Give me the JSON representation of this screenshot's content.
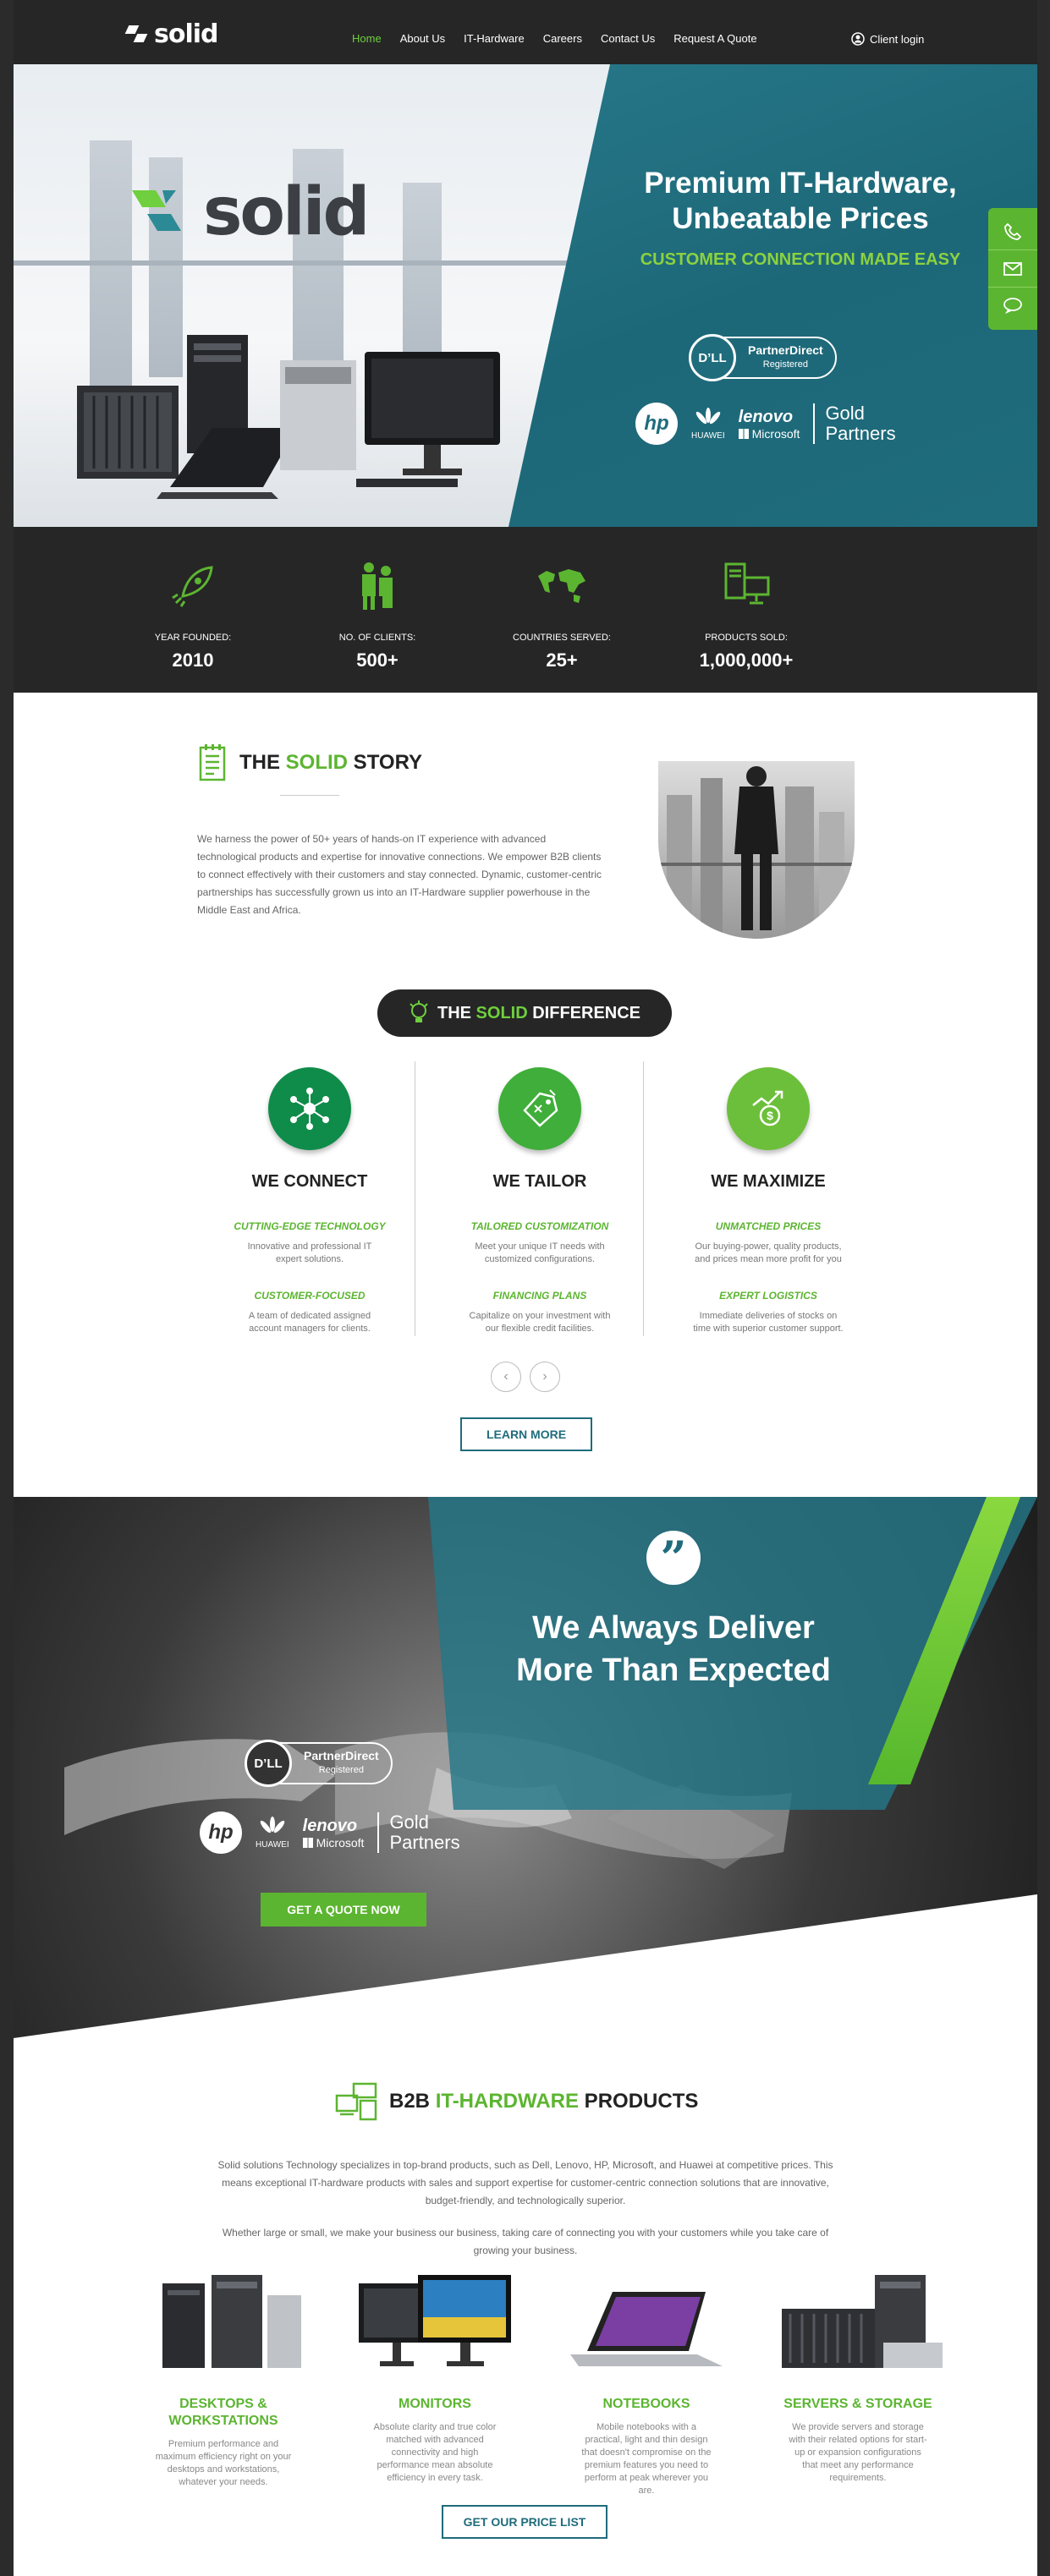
{
  "nav": {
    "logo": "solid",
    "items": [
      {
        "label": "Home",
        "active": true
      },
      {
        "label": "About Us"
      },
      {
        "label": "IT-Hardware"
      },
      {
        "label": "Careers"
      },
      {
        "label": "Contact Us"
      },
      {
        "label": "Request A Quote"
      }
    ],
    "client_login": "Client login"
  },
  "hero": {
    "logo": "solid",
    "title_line1": "Premium IT-Hardware,",
    "title_line2": "Unbeatable Prices",
    "subtitle": "CUSTOMER CONNECTION MADE EASY",
    "dell": "D’LL",
    "partner_direct": "PartnerDirect",
    "registered": "Registered",
    "hp": "hp",
    "huawei": "HUAWEI",
    "lenovo": "lenovo",
    "microsoft": "Microsoft",
    "gold": "Gold",
    "partners": "Partners"
  },
  "stats": [
    {
      "label": "YEAR FOUNDED:",
      "value": "2010"
    },
    {
      "label": "NO. OF CLIENTS:",
      "value": "500+"
    },
    {
      "label": "COUNTRIES SERVED:",
      "value": "25+"
    },
    {
      "label": "PRODUCTS SOLD:",
      "value": "1,000,000+"
    }
  ],
  "story": {
    "title_a": "THE ",
    "title_b": "SOLID",
    "title_c": " STORY",
    "text": "We harness the power of 50+ years of hands-on IT experience with advanced technological products and expertise for innovative connections. We empower B2B clients to connect effectively with their customers and stay connected. Dynamic, customer-centric partnerships has successfully grown us into an IT-Hardware supplier powerhouse in the Middle East and Africa."
  },
  "difference": {
    "title_a": "THE ",
    "title_b": "SOLID",
    "title_c": " DIFFERENCE",
    "columns": [
      {
        "heading": "WE CONNECT",
        "t1": "CUTTING-EDGE TECHNOLOGY",
        "d1": "Innovative and professional IT expert solutions.",
        "t2": "CUSTOMER-FOCUSED",
        "d2": "A team of dedicated assigned account managers for clients."
      },
      {
        "heading": "WE TAILOR",
        "t1": "TAILORED CUSTOMIZATION",
        "d1": "Meet your unique IT needs with customized configurations.",
        "t2": "FINANCING PLANS",
        "d2": "Capitalize on your investment with our flexible credit facilities."
      },
      {
        "heading": "WE MAXIMIZE",
        "t1": "UNMATCHED PRICES",
        "d1": "Our buying-power, quality products, and prices mean more profit for you",
        "t2": "EXPERT LOGISTICS",
        "d2": "Immediate deliveries of  stocks on time with superior customer support."
      }
    ],
    "learn_more": "LEARN MORE"
  },
  "deliver": {
    "line1": "We Always Deliver",
    "line2": "More Than Expected",
    "quote_button": "GET A QUOTE NOW"
  },
  "products": {
    "title_a": "B2B ",
    "title_b": "IT-HARDWARE",
    "title_c": " PRODUCTS",
    "p1": "Solid solutions Technology specializes in top-brand products, such as Dell, Lenovo, HP, Microsoft, and Huawei at competitive prices. This means exceptional IT-hardware products with sales and support expertise for customer-centric connection solutions that are innovative, budget-friendly, and technologically superior.",
    "p2": "Whether large or small, we make your business our business, taking care of connecting you with your customers while you take care of growing your business.",
    "items": [
      {
        "name": "DESKTOPS & WORKSTATIONS",
        "desc": "Premium performance and maximum efficiency right on your desktops and workstations, whatever your needs."
      },
      {
        "name": "MONITORS",
        "desc": "Absolute clarity and true color matched with advanced connectivity and high performance mean absolute efficiency in every task."
      },
      {
        "name": "NOTEBOOKS",
        "desc": "Mobile notebooks with a practical, light and thin design that doesn't compromise on the premium features you need to perform at peak wherever you are."
      },
      {
        "name": "SERVERS & STORAGE",
        "desc": "We provide servers and storage with their related options for start-up or expansion configurations that meet any performance requirements."
      }
    ],
    "price_list": "GET OUR PRICE LIST"
  },
  "colors": {
    "green": "#5cb531",
    "teal": "#1f6c7c",
    "dark": "#262626"
  }
}
